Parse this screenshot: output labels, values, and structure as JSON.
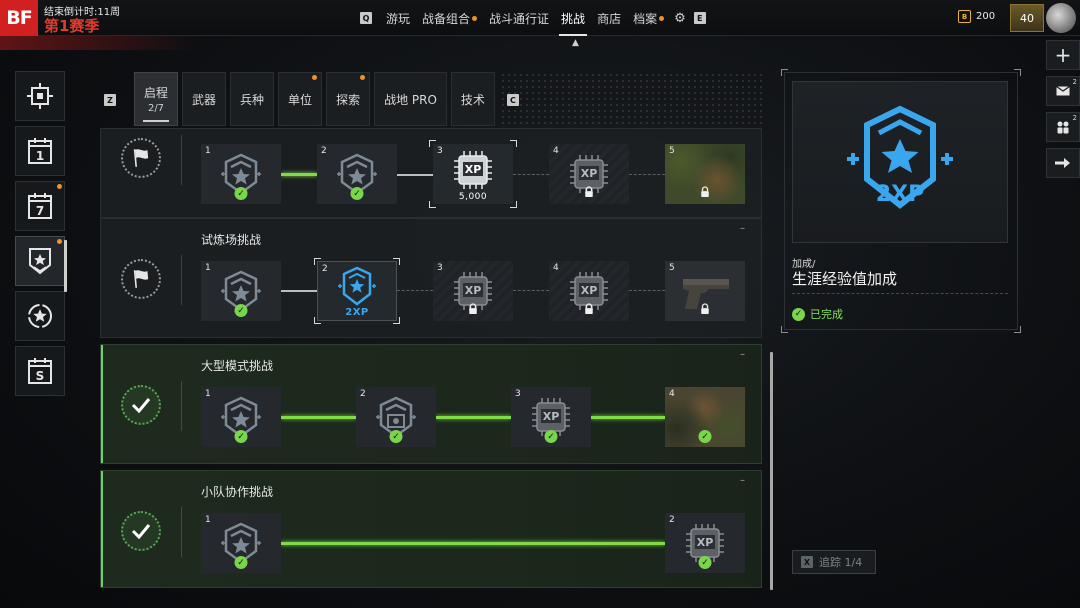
{
  "brand": "BF",
  "season": {
    "timer": "结束倒计时:11周",
    "name": "第1赛季"
  },
  "nav": {
    "key_left": "Q",
    "key_right": "E",
    "items": [
      {
        "label": "游玩",
        "active": false,
        "dot": false
      },
      {
        "label": "战备组合",
        "active": false,
        "dot": true
      },
      {
        "label": "战斗通行证",
        "active": false,
        "dot": false
      },
      {
        "label": "挑战",
        "active": true,
        "dot": false
      },
      {
        "label": "商店",
        "active": false,
        "dot": false
      },
      {
        "label": "档案",
        "active": false,
        "dot": true
      }
    ],
    "settings_icon": "gear-icon"
  },
  "currency": {
    "amount": "200",
    "icon": "bf-coin-icon"
  },
  "player": {
    "level": "40"
  },
  "sidebar": {
    "items": [
      {
        "icon": "crosshair-icon",
        "active": false,
        "dot": false
      },
      {
        "icon": "calendar-1-icon",
        "label": "1",
        "active": false,
        "dot": false
      },
      {
        "icon": "calendar-7-icon",
        "label": "7",
        "active": false,
        "dot": true
      },
      {
        "icon": "badge-star-icon",
        "active": true,
        "dot": true
      },
      {
        "icon": "star-circle-icon",
        "active": false,
        "dot": false
      },
      {
        "icon": "calendar-s-icon",
        "label": "S",
        "active": false,
        "dot": false
      }
    ]
  },
  "tabs": {
    "key_left": "Z",
    "key_right": "C",
    "items": [
      {
        "label": "启程",
        "sub": "2/7",
        "active": true,
        "dot": false
      },
      {
        "label": "武器",
        "sub": "",
        "active": false,
        "dot": false
      },
      {
        "label": "兵种",
        "sub": "",
        "active": false,
        "dot": false
      },
      {
        "label": "单位",
        "sub": "",
        "active": false,
        "dot": true
      },
      {
        "label": "探索",
        "sub": "",
        "active": false,
        "dot": true
      },
      {
        "label": "战地 PRO",
        "sub": "",
        "active": false,
        "dot": false
      },
      {
        "label": "技术",
        "sub": "",
        "active": false,
        "dot": false
      }
    ]
  },
  "challenges": [
    {
      "title": "",
      "status": "in-progress",
      "nodes": [
        {
          "num": "1",
          "reward": "rank-badge-icon",
          "state": "completed"
        },
        {
          "num": "2",
          "reward": "rank-badge-icon",
          "state": "completed"
        },
        {
          "num": "3",
          "reward": "xp-chip-icon",
          "state": "current",
          "value": "5,000"
        },
        {
          "num": "4",
          "reward": "xp-chip-icon",
          "state": "locked"
        },
        {
          "num": "5",
          "reward": "camo-skin",
          "state": "locked"
        }
      ]
    },
    {
      "title": "试炼场挑战",
      "status": "in-progress",
      "nodes": [
        {
          "num": "1",
          "reward": "rank-badge-icon",
          "state": "completed"
        },
        {
          "num": "2",
          "reward": "2xp-boost-icon",
          "state": "selected",
          "label": "2XP"
        },
        {
          "num": "3",
          "reward": "xp-chip-icon",
          "state": "locked"
        },
        {
          "num": "4",
          "reward": "xp-chip-icon",
          "state": "locked"
        },
        {
          "num": "5",
          "reward": "pistol-skin",
          "state": "locked"
        }
      ]
    },
    {
      "title": "大型模式挑战",
      "status": "completed",
      "nodes": [
        {
          "num": "1",
          "reward": "rank-badge-icon",
          "state": "completed"
        },
        {
          "num": "2",
          "reward": "rank-badge-camera-icon",
          "state": "completed"
        },
        {
          "num": "3",
          "reward": "xp-chip-icon",
          "state": "completed"
        },
        {
          "num": "4",
          "reward": "camo-skin",
          "state": "completed"
        }
      ]
    },
    {
      "title": "小队协作挑战",
      "status": "completed",
      "nodes": [
        {
          "num": "1",
          "reward": "rank-badge-icon",
          "state": "completed"
        },
        {
          "num": "2",
          "reward": "xp-chip-icon",
          "state": "completed"
        }
      ]
    }
  ],
  "detail": {
    "reward_label": "2XP",
    "category": "加成/",
    "title": "生涯经验值加成",
    "status": "已完成",
    "track_key": "X",
    "track_label": "追踪 1/4"
  },
  "right_strip": [
    {
      "icon": "plus-icon",
      "badge": ""
    },
    {
      "icon": "mail-icon",
      "badge": "2"
    },
    {
      "icon": "squad-icon",
      "badge": "2"
    },
    {
      "icon": "exit-arrow-icon",
      "badge": ""
    }
  ],
  "colors": {
    "accent_blue": "#3aa6ee",
    "complete_green": "#79d54b",
    "notify_orange": "#f0922b",
    "brand_red": "#d21f1f"
  }
}
